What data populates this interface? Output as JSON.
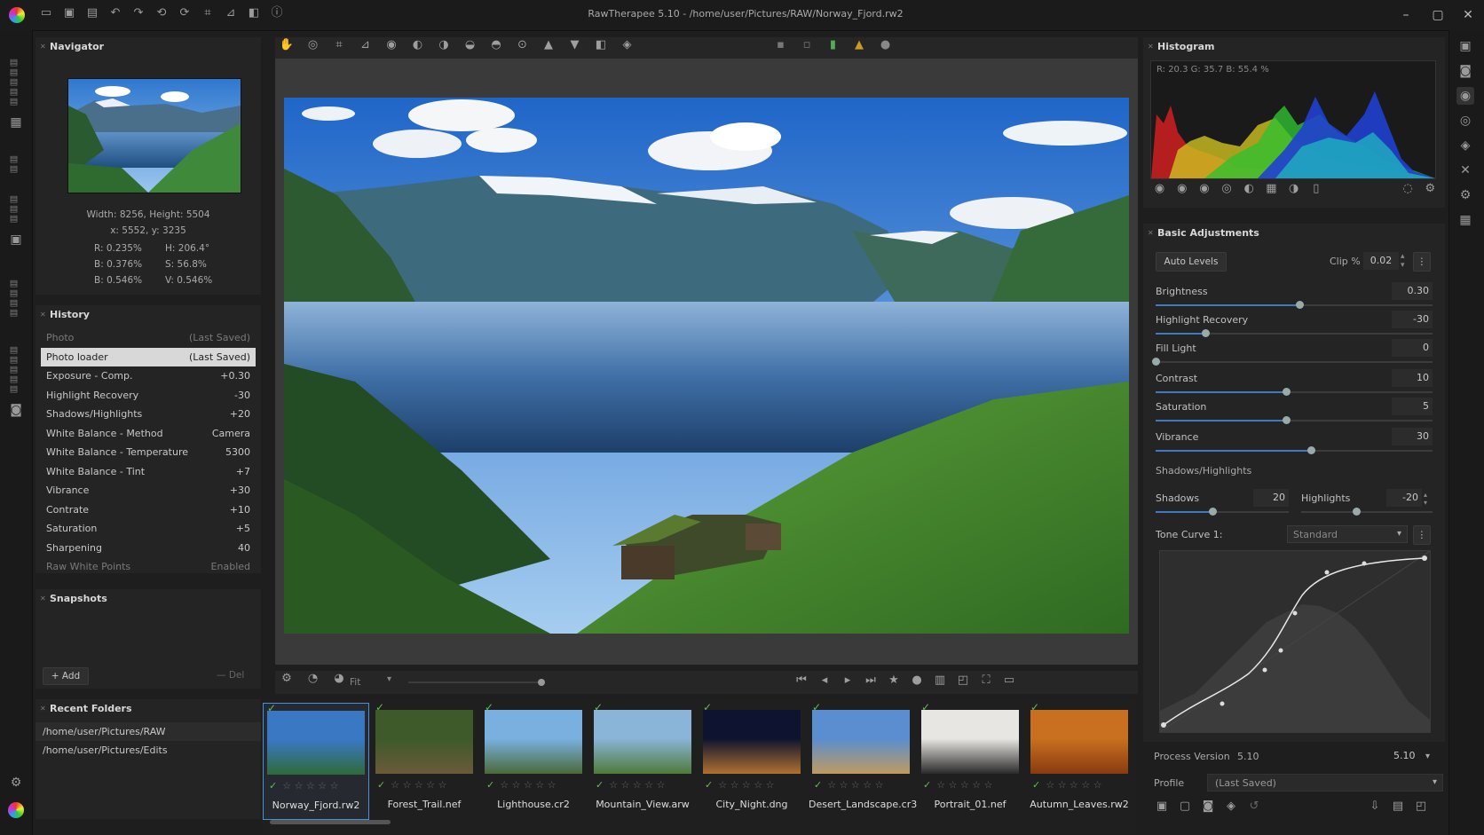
{
  "window": {
    "title": "RawTherapee 5.10 - /home/user/Pictures/RAW/Norway_Fjord.rw2",
    "minimize": "–",
    "maximize": "▢",
    "close": "✕"
  },
  "navigator": {
    "title": "Navigator",
    "size": "Width: 8256, Height: 5504",
    "coords": "x: 5552, y: 3235",
    "r": "R: 0.235%",
    "g": "B: 0.376%",
    "b": "B: 0.546%",
    "h": "H: 206.4°",
    "s": "S: 56.8%",
    "v": "V: 0.546%"
  },
  "history": {
    "title": "History",
    "items": [
      {
        "label": "Photo",
        "value": "(Last Saved)",
        "state": "dim"
      },
      {
        "label": "Photo loader",
        "value": "(Last Saved)",
        "state": "sel"
      },
      {
        "label": "Exposure - Comp.",
        "value": "+0.30",
        "state": ""
      },
      {
        "label": "Highlight Recovery",
        "value": "-30",
        "state": ""
      },
      {
        "label": "Shadows/Highlights",
        "value": "+20",
        "state": ""
      },
      {
        "label": "White Balance - Method",
        "value": "Camera",
        "state": ""
      },
      {
        "label": "White Balance - Temperature",
        "value": "5300",
        "state": ""
      },
      {
        "label": "White Balance - Tint",
        "value": "+7",
        "state": ""
      },
      {
        "label": "Vibrance",
        "value": "+30",
        "state": ""
      },
      {
        "label": "Contrate",
        "value": "+10",
        "state": ""
      },
      {
        "label": "Saturation",
        "value": "+5",
        "state": ""
      },
      {
        "label": "Sharpening",
        "value": "40",
        "state": ""
      },
      {
        "label": "Raw White Points",
        "value": "Enabled",
        "state": "dim"
      }
    ]
  },
  "snapshots": {
    "title": "Snapshots",
    "add": "Add",
    "del": "Del"
  },
  "recent_folders": {
    "title": "Recent Folders",
    "items": [
      "/home/user/Pictures/RAW",
      "/home/user/Pictures/Edits"
    ]
  },
  "view": {
    "zoom": "Fit"
  },
  "filmstrip": [
    {
      "name": "Norway_Fjord.rw2",
      "selected": true,
      "c1": "#3a78c4",
      "c2": "#2f6a3a"
    },
    {
      "name": "Forest_Trail.nef",
      "selected": false,
      "c1": "#3e5a2a",
      "c2": "#6a5a3a"
    },
    {
      "name": "Lighthouse.cr2",
      "selected": false,
      "c1": "#7ab0e0",
      "c2": "#4a6a3a"
    },
    {
      "name": "Mountain_View.arw",
      "selected": false,
      "c1": "#8ab4d8",
      "c2": "#4f7a3a"
    },
    {
      "name": "City_Night.dng",
      "selected": false,
      "c1": "#0e1430",
      "c2": "#b07030"
    },
    {
      "name": "Desert_Landscape.cr3",
      "selected": false,
      "c1": "#5a8ed0",
      "c2": "#c09a60"
    },
    {
      "name": "Portrait_01.nef",
      "selected": false,
      "c1": "#e8e6e2",
      "c2": "#2a2a2a"
    },
    {
      "name": "Autumn_Leaves.rw2",
      "selected": false,
      "c1": "#c87020",
      "c2": "#8a3a10"
    }
  ],
  "histogram": {
    "title": "Histogram",
    "readout": "R: 20.3   G: 35.7   B: 55.4   %"
  },
  "basic": {
    "title": "Basic Adjustments",
    "auto_levels": "Auto Levels",
    "clip_label": "Clip %",
    "clip_value": "0.02",
    "sliders": [
      {
        "label": "Brightness",
        "value": "0.30",
        "pos": 0.52
      },
      {
        "label": "Highlight Recovery",
        "value": "-30",
        "pos": 0.18
      },
      {
        "label": "Fill Light",
        "value": "0",
        "pos": 0.0
      },
      {
        "label": "Contrast",
        "value": "10",
        "pos": 0.47
      },
      {
        "label": "Saturation",
        "value": "5",
        "pos": 0.47
      },
      {
        "label": "Vibrance",
        "value": "30",
        "pos": 0.56
      }
    ],
    "sh_title": "Shadows/Highlights",
    "shadows_label": "Shadows",
    "shadows_value": "20",
    "highlights_label": "Highlights",
    "highlights_value": "-20",
    "tone_curve_label": "Tone Curve 1:",
    "tone_curve_value": "Standard"
  },
  "footer": {
    "process_version_label": "Process Version",
    "process_version": "5.10",
    "process_version_sel": "5.10",
    "profile_label": "Profile",
    "profile_value": "(Last Saved)"
  }
}
